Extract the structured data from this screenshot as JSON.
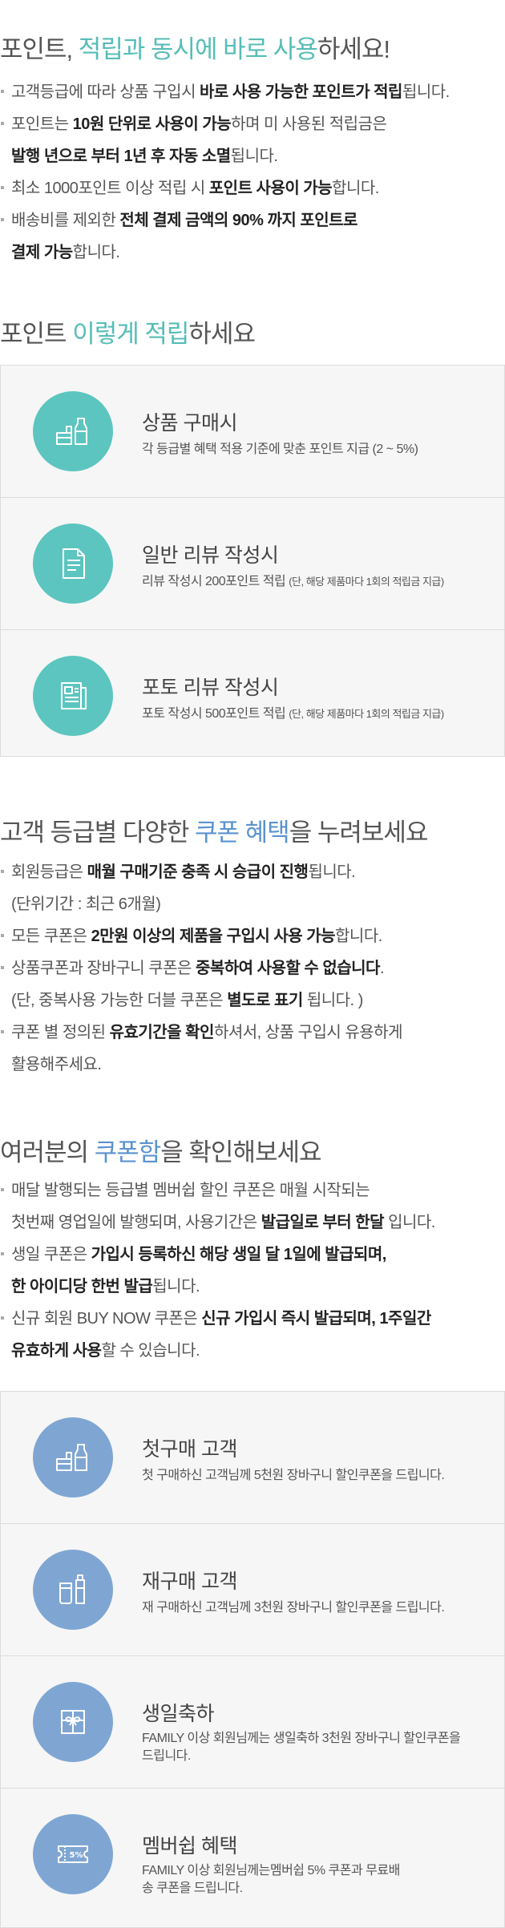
{
  "section1": {
    "title_pre": "포인트, ",
    "title_hl": "적립과 동시에 바로 사용",
    "title_post": "하세요!",
    "bullets": [
      {
        "lines": [
          [
            {
              "t": "고객등급에 따라 상품 구입시 "
            },
            {
              "t": "바로 사용 가능한 포인트가 적립",
              "b": true
            },
            {
              "t": "됩니다."
            }
          ]
        ]
      },
      {
        "lines": [
          [
            {
              "t": "포인트는 "
            },
            {
              "t": "10원 단위로 사용이 가능",
              "b": true
            },
            {
              "t": "하며 미 사용된 적립금은"
            }
          ],
          [
            {
              "t": "발행 년으로 부터 1년 후 자동 소멸",
              "b": true
            },
            {
              "t": "됩니다."
            }
          ]
        ]
      },
      {
        "lines": [
          [
            {
              "t": "최소 1000포인트 이상 적립 시 "
            },
            {
              "t": "포인트 사용이 가능",
              "b": true
            },
            {
              "t": "합니다."
            }
          ]
        ]
      },
      {
        "lines": [
          [
            {
              "t": "배송비를 제외한 "
            },
            {
              "t": "전체 결제 금액의 90% 까지 포인트로",
              "b": true
            }
          ],
          [
            {
              "t": "결제 가능",
              "b": true
            },
            {
              "t": "합니다."
            }
          ]
        ]
      }
    ]
  },
  "section2": {
    "title_pre": "포인트 ",
    "title_hl": "이렇게 적립",
    "title_post": "하세요",
    "cards": [
      {
        "icon": "shopping-products-icon",
        "title": "상품 구매시",
        "desc": "각 등급별 혜택 적용 기준에 맞춘 포인트 지급 (2 ~ 5%)",
        "note": ""
      },
      {
        "icon": "document-icon",
        "title": "일반 리뷰 작성시",
        "desc": "리뷰 작성시 200포인트 적립 ",
        "note": "(단, 해당 제품마다 1회의 적립금 지급)"
      },
      {
        "icon": "photo-review-icon",
        "title": "포토 리뷰 작성시",
        "desc": "포토 작성시 500포인트 적립 ",
        "note": "(단, 해당 제품마다 1회의 적립금 지급)"
      }
    ]
  },
  "section3": {
    "title_pre": "고객 등급별 다양한 ",
    "title_hl": "쿠폰 혜택",
    "title_post": "을 누려보세요",
    "bullets": [
      {
        "lines": [
          [
            {
              "t": "회원등급은 "
            },
            {
              "t": "매월 구매기준 충족 시 승급이 진행",
              "b": true
            },
            {
              "t": "됩니다."
            }
          ],
          [
            {
              "t": "(단위기간 : 최근 6개월)"
            }
          ]
        ]
      },
      {
        "lines": [
          [
            {
              "t": "모든 쿠폰은 "
            },
            {
              "t": "2만원 이상의 제품을 구입시 사용 가능",
              "b": true
            },
            {
              "t": "합니다."
            }
          ]
        ]
      },
      {
        "lines": [
          [
            {
              "t": "상품쿠폰과 장바구니 쿠폰은 "
            },
            {
              "t": "중복하여 사용할 수 없습니다",
              "b": true
            },
            {
              "t": "."
            }
          ],
          [
            {
              "t": "(단, 중복사용 가능한 더블 쿠폰은 "
            },
            {
              "t": "별도로 표기",
              "b": true
            },
            {
              "t": " 됩니다. )"
            }
          ]
        ]
      },
      {
        "lines": [
          [
            {
              "t": "쿠폰 별 정의된 "
            },
            {
              "t": "유효기간을 확인",
              "b": true
            },
            {
              "t": "하셔서, 상품 구입시 유용하게"
            }
          ],
          [
            {
              "t": "활용해주세요."
            }
          ]
        ]
      }
    ]
  },
  "section4": {
    "title_pre": "여러분의 ",
    "title_hl": "쿠폰함",
    "title_post": "을 확인해보세요",
    "bullets": [
      {
        "lines": [
          [
            {
              "t": "매달 발행되는 등급별 멤버쉽 할인 쿠폰은 매월 시작되는"
            }
          ],
          [
            {
              "t": "첫번째 영업일에 발행되며,  사용기간은  "
            },
            {
              "t": "발급일로 부터 한달",
              "b": true
            },
            {
              "t": " 입니다."
            }
          ]
        ]
      },
      {
        "lines": [
          [
            {
              "t": "생일 쿠폰은 "
            },
            {
              "t": "가입시 등록하신 해당 생일 달 1일에 발급되며,",
              "b": true
            }
          ],
          [
            {
              "t": "한 아이디당 한번 발급",
              "b": true
            },
            {
              "t": "됩니다."
            }
          ]
        ]
      },
      {
        "lines": [
          [
            {
              "t": "신규 회원 BUY NOW 쿠폰은 "
            },
            {
              "t": "신규 가입시 즉시 발급되며, 1주일간",
              "b": true
            }
          ],
          [
            {
              "t": "유효하게 사용",
              "b": true
            },
            {
              "t": "할 수 있습니다."
            }
          ]
        ]
      }
    ],
    "cards": [
      {
        "icon": "shopping-products-icon",
        "title": "첫구매 고객",
        "desc": "첫 구매하신 고객님께 5천원 장바구니 할인쿠폰을 드립니다."
      },
      {
        "icon": "cosmetics-icon",
        "title": "재구매 고객",
        "desc": "재 구매하신 고객님께 3천원 장바구니 할인쿠폰을 드립니다."
      },
      {
        "icon": "gift-icon",
        "title": "생일축하",
        "desc": "FAMILY 이상 회원님께는 생일축하 3천원 장바구니 할인쿠폰을 드립니다."
      },
      {
        "icon": "coupon-ticket-icon",
        "title": "멤버쉽 혜택",
        "desc": "FAMILY 이상 회원님께는멤버쉽 5% 쿠폰과 무료배송 쿠폰을 드립니다.",
        "badge": "5%"
      }
    ]
  },
  "colors": {
    "teal": "#5dc5bf",
    "blue": "#7fa6d3",
    "highlight_teal": "#56bdb7",
    "highlight_blue": "#5b93cf"
  }
}
